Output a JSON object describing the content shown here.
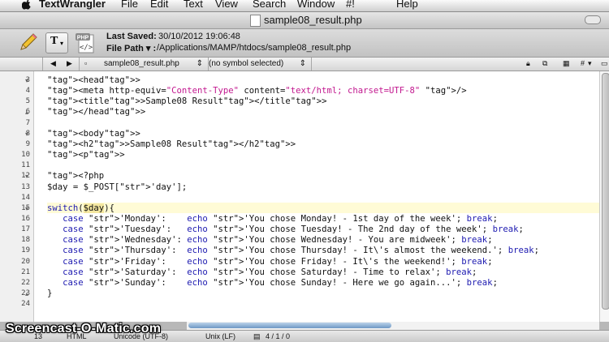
{
  "menubar": {
    "apple": "",
    "items": [
      "TextWrangler",
      "File",
      "Edit",
      "Text",
      "View",
      "Search",
      "Window",
      "#!",
      "Help"
    ]
  },
  "window": {
    "title": "sample08_result.php"
  },
  "toolbar": {
    "text_button": "T",
    "file_badge": "PHP",
    "last_saved_label": "Last Saved:",
    "last_saved_value": "30/10/2012 19:06:48",
    "file_path_label": "File Path ▾ :",
    "file_path_value": "/Applications/MAMP/htdocs/sample08_result.php"
  },
  "navbar": {
    "back": "◀",
    "forward": "▶",
    "file": "sample08_result.php",
    "symbol": "(no symbol selected)",
    "hash": "#"
  },
  "editor": {
    "lines": [
      {
        "num": "3",
        "code": "<head>"
      },
      {
        "num": "4",
        "code": "<meta http-equiv=\"Content-Type\" content=\"text/html; charset=UTF-8\" />"
      },
      {
        "num": "5",
        "code": "<title>Sample08 Result</title>"
      },
      {
        "num": "6",
        "code": "</head>"
      },
      {
        "num": "7",
        "code": ""
      },
      {
        "num": "8",
        "code": "<body>"
      },
      {
        "num": "9",
        "code": "<h2>Sample08 Result</h2>"
      },
      {
        "num": "10",
        "code": "<p>"
      },
      {
        "num": "11",
        "code": ""
      },
      {
        "num": "12",
        "code": "<?php"
      },
      {
        "num": "13",
        "code": "$day = $_POST['day'];"
      },
      {
        "num": "14",
        "code": ""
      },
      {
        "num": "15",
        "code": "switch($day){"
      },
      {
        "num": "16",
        "code": "   case 'Monday':    echo 'You chose Monday! - 1st day of the week'; break;"
      },
      {
        "num": "17",
        "code": "   case 'Tuesday':   echo 'You chose Tuesday! - The 2nd day of the week'; break;"
      },
      {
        "num": "18",
        "code": "   case 'Wednesday': echo 'You chose Wednesday! - You are midweek'; break;"
      },
      {
        "num": "19",
        "code": "   case 'Thursday':  echo 'You chose Thursday! - It\\'s almost the weekend.'; break;"
      },
      {
        "num": "20",
        "code": "   case 'Friday':    echo 'You chose Friday! - It\\'s the weekend!'; break;"
      },
      {
        "num": "21",
        "code": "   case 'Saturday':  echo 'You chose Saturday! - Time to relax'; break;"
      },
      {
        "num": "22",
        "code": "   case 'Sunday':    echo 'You chose Sunday! - Here we go again...'; break;"
      },
      {
        "num": "23",
        "code": "}"
      },
      {
        "num": "24",
        "code": ""
      }
    ]
  },
  "statusbar": {
    "line": "13",
    "language": "HTML",
    "encoding": "Unicode (UTF-8)",
    "line_endings": "Unix (LF)",
    "doc_stats": "4 / 1 / 0"
  },
  "watermark": "Screencast-O-Matic.com",
  "colors": {
    "tag": "#1d1ab0",
    "string": "#c2188f",
    "current_line": "#fffbd6"
  }
}
